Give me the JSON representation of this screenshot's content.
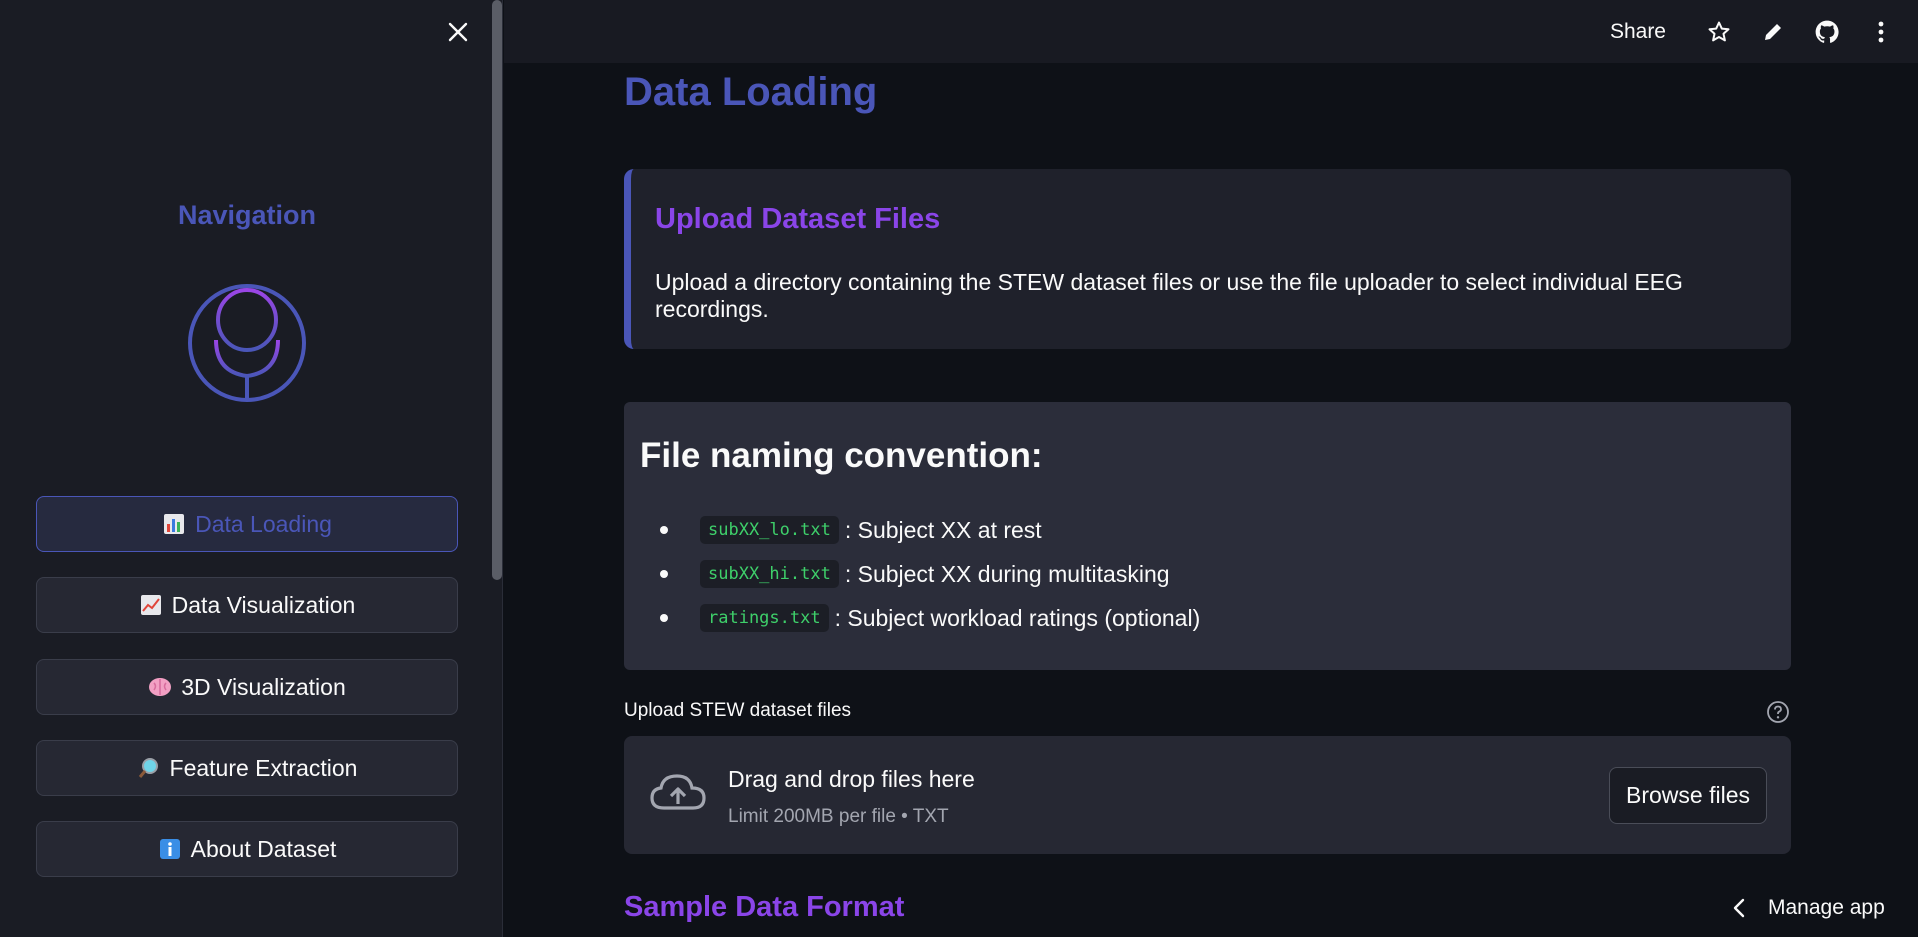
{
  "header": {
    "share_label": "Share",
    "icons": [
      "star-icon",
      "pencil-icon",
      "github-icon",
      "more-vertical-icon"
    ]
  },
  "sidebar": {
    "title": "Navigation",
    "items": [
      {
        "label": "Data Loading",
        "icon": "bar-chart-emoji",
        "active": true
      },
      {
        "label": "Data Visualization",
        "icon": "chart-increasing-emoji",
        "active": false
      },
      {
        "label": "3D Visualization",
        "icon": "brain-emoji",
        "active": false
      },
      {
        "label": "Feature Extraction",
        "icon": "magnifier-emoji",
        "active": false
      },
      {
        "label": "About Dataset",
        "icon": "info-emoji",
        "active": false
      }
    ]
  },
  "main": {
    "title": "Data Loading",
    "info_card": {
      "title": "Upload Dataset Files",
      "text": "Upload a directory containing the STEW dataset files or use the file uploader to select individual EEG recordings."
    },
    "naming": {
      "title": "File naming convention:",
      "items": [
        {
          "code": "subXX_lo.txt",
          "text": ": Subject XX at rest"
        },
        {
          "code": "subXX_hi.txt",
          "text": ": Subject XX during multitasking"
        },
        {
          "code": "ratings.txt",
          "text": ": Subject workload ratings (optional)"
        }
      ]
    },
    "uploader": {
      "label": "Upload STEW dataset files",
      "drag_text": "Drag and drop files here",
      "limit_text": "Limit 200MB per file • TXT",
      "browse_label": "Browse files"
    },
    "sample_title": "Sample Data Format"
  },
  "footer": {
    "manage_label": "Manage app"
  },
  "colors": {
    "accent": "#4a56b8",
    "purple": "#8a45e8",
    "code": "#3ecf6a"
  }
}
